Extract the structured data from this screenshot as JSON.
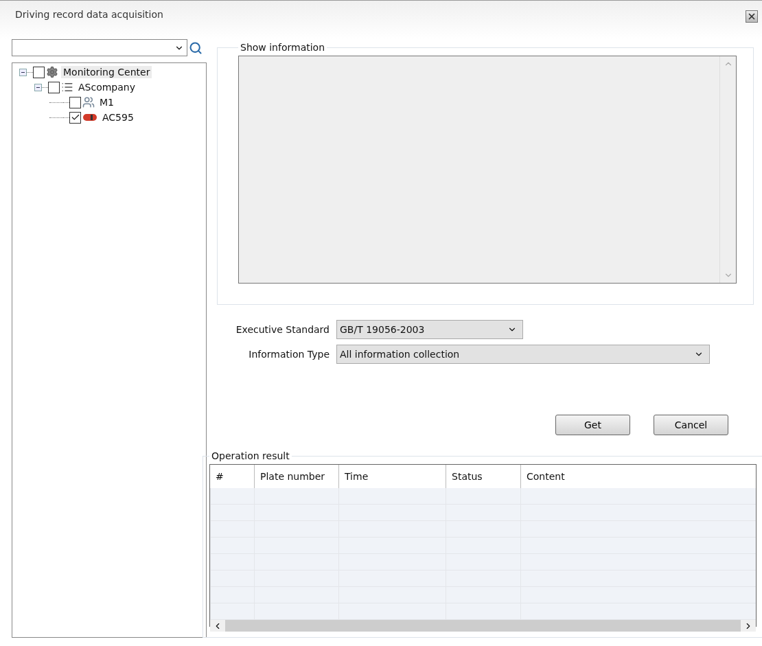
{
  "window": {
    "title": "Driving record data acquisition"
  },
  "tree": [
    {
      "label": "Monitoring Center",
      "kind": "center",
      "checked": false,
      "selected": true,
      "expanded": true,
      "children": [
        {
          "label": "AScompany",
          "kind": "company",
          "checked": false,
          "selected": false,
          "expanded": true,
          "children": [
            {
              "label": "M1",
              "kind": "group",
              "checked": false,
              "selected": false
            },
            {
              "label": "AC595",
              "kind": "vehicle",
              "checked": true,
              "selected": false
            }
          ]
        }
      ]
    }
  ],
  "show_information": {
    "title": "Show information"
  },
  "form": [
    {
      "label": "Executive Standard",
      "value": "GB/T 19056-2003",
      "wide": false
    },
    {
      "label": "Information Type",
      "value": "All information collection",
      "wide": true
    }
  ],
  "buttons": [
    "Get",
    "Cancel"
  ],
  "operation_result": {
    "title": "Operation result",
    "columns": [
      "#",
      "Plate number",
      "Time",
      "Status",
      "Content"
    ]
  }
}
